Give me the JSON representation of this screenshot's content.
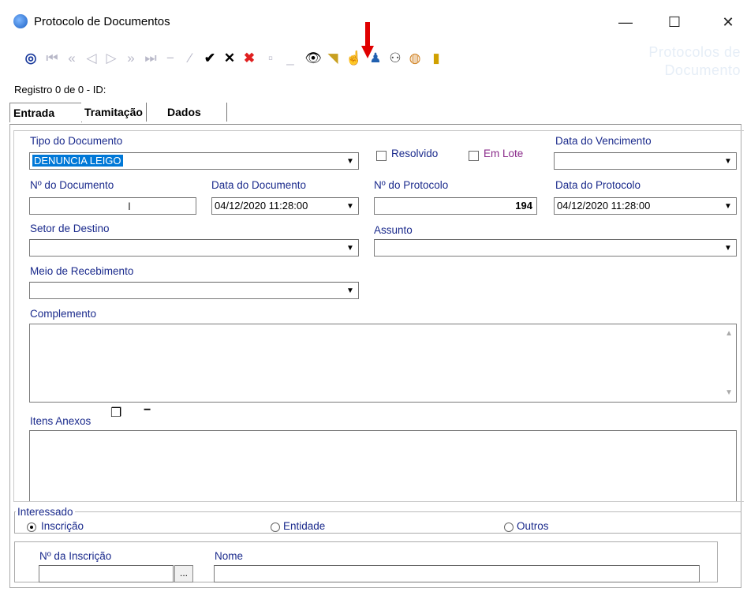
{
  "window": {
    "title": "Protocolo de Documentos",
    "minimize": "—",
    "maximize": "☐",
    "close": "✕"
  },
  "watermark": {
    "line1": "Protocolos de",
    "line2": "Documento"
  },
  "toolbar": {
    "icons": [
      "refresh",
      "first",
      "prev-page",
      "prev",
      "next",
      "next-page",
      "last",
      "insert",
      "edit",
      "confirm",
      "cancel",
      "delete",
      "blank",
      "minus",
      "search",
      "filter",
      "copy",
      "users",
      "person-link",
      "globe",
      "exit"
    ]
  },
  "registro": "Registro 0 de 0 - ID:",
  "tabs": [
    "Entrada",
    "Tramitação",
    "Dados Adicionais"
  ],
  "form": {
    "tipo_label": "Tipo do Documento",
    "tipo_value": "DENUNCIA LEIGO",
    "resolvido": "Resolvido",
    "em_lote": "Em Lote",
    "venc_label": "Data do Vencimento",
    "num_doc_label": "Nº do Documento",
    "data_doc_label": "Data do Documento",
    "data_doc_value": "04/12/2020 11:28:00",
    "num_prot_label": "Nº do Protocolo",
    "num_prot_value": "194",
    "data_prot_label": "Data do Protocolo",
    "data_prot_value": "04/12/2020 11:28:00",
    "setor_label": "Setor de Destino",
    "assunto_label": "Assunto",
    "meio_label": "Meio de Recebimento",
    "complemento_label": "Complemento",
    "itens_label": "Itens Anexos"
  },
  "interessado": {
    "legend": "Interessado",
    "options": [
      "Inscrição",
      "Entidade",
      "Outros"
    ],
    "selected": "Inscrição"
  },
  "bottom": {
    "inscricao_label": "Nº da Inscrição",
    "nome_label": "Nome",
    "dots": "..."
  }
}
